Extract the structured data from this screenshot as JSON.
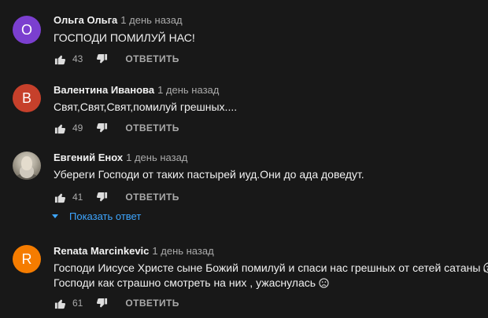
{
  "comments": [
    {
      "avatar_letter": "О",
      "avatar_color": "#7b3fcf",
      "author": "Ольга Ольга",
      "time": "1 день назад",
      "lines": [
        "ГОСПОДИ ПОМИЛУЙ НАС!"
      ],
      "likes": "43",
      "reply_label": "ОТВЕТИТЬ"
    },
    {
      "avatar_letter": "В",
      "avatar_color": "#c6402b",
      "author": "Валентина Иванова",
      "time": "1 день назад",
      "lines": [
        "Свят,Свят,Свят,помилуй грешных...."
      ],
      "likes": "49",
      "reply_label": "ОТВЕТИТЬ"
    },
    {
      "avatar_letter": "",
      "avatar_color": "#9e988a",
      "author": "Евгений Енох",
      "time": "1 день назад",
      "lines": [
        "Убереги Господи от таких пастырей иуд.Они до ада доведут."
      ],
      "likes": "41",
      "reply_label": "ОТВЕТИТЬ",
      "show_replies": "Показать ответ"
    },
    {
      "avatar_letter": "R",
      "avatar_color": "#f57c00",
      "author": "Renata Marcinkevic",
      "time": "1 день назад",
      "lines": [
        "Господи Иисусе Христе  сыне Божий помилуй и спаси  нас грешных  от сетей сатаны",
        "Господи как   страшно  смотреть  на них , ужаснулась"
      ],
      "line_emoji": [
        "scream-emoji",
        "sad-face-emoji"
      ],
      "likes": "61",
      "reply_label": "ОТВЕТИТЬ"
    }
  ],
  "icons": {
    "like": "thumbs-up-icon",
    "dislike": "thumbs-down-icon",
    "expand": "caret-down-icon"
  },
  "colors": {
    "background": "#181818",
    "text": "#f1f1f1",
    "secondary": "#aaaaaa",
    "link": "#3ea6ff"
  }
}
